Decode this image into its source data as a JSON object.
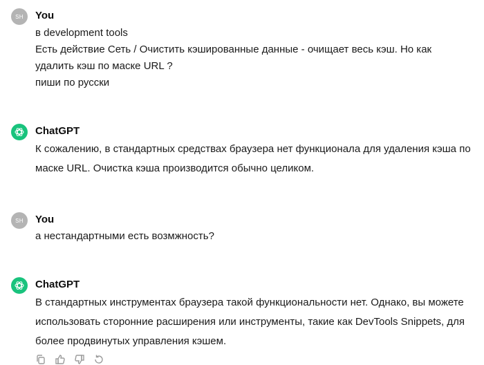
{
  "conversation": [
    {
      "role": "user",
      "avatar_initials": "SH",
      "author": "You",
      "lines": [
        "в development tools",
        "Есть действие Сеть / Очистить кэшированные данные - очищает весь кэш. Но как",
        "удалить кэш по маске URL ?",
        "пиши по русски"
      ]
    },
    {
      "role": "assistant",
      "author": "ChatGPT",
      "text": "К сожалению, в стандартных средствах браузера нет функционала для удаления кэша по маске URL. Очистка кэша производится обычно целиком."
    },
    {
      "role": "user",
      "avatar_initials": "SH",
      "author": "You",
      "lines": [
        "а нестандартными есть возмжность?"
      ]
    },
    {
      "role": "assistant",
      "author": "ChatGPT",
      "text": "В стандартных инструментах браузера такой функциональности нет. Однако, вы можете использовать сторонние расширения или инструменты, такие как DevTools Snippets, для более продвинутых управления кэшем."
    }
  ],
  "actions": [
    "copy-icon",
    "thumbs-up-icon",
    "thumbs-down-icon",
    "regenerate-icon"
  ],
  "colors": {
    "gpt_avatar": "#19c37d",
    "user_avatar": "#b4b4b4",
    "icon": "#9b9b9b"
  }
}
